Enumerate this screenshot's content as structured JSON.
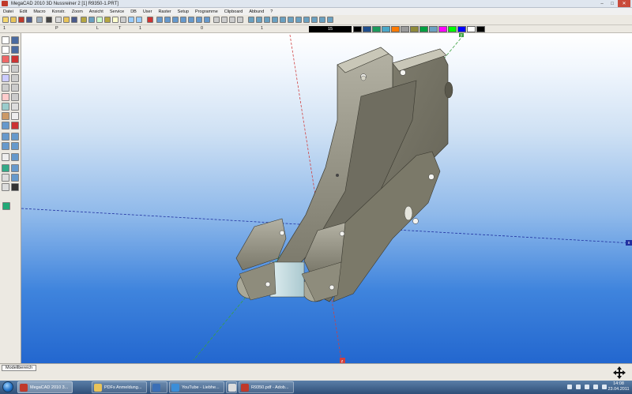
{
  "window": {
    "title": "MegaCAD 2010 3D Nussreiner 2 [1] R9350-1.PRT]",
    "controls": [
      "–",
      "□",
      "✕"
    ]
  },
  "menu": [
    "Datei",
    "Edit",
    "Macro",
    "Konstr.",
    "Zoom",
    "Ansicht",
    "Service",
    "DB",
    "User",
    "Raster",
    "Setup",
    "Programme",
    "Clipboard",
    "Abbund",
    "?"
  ],
  "layerbar": {
    "layer_value": "15",
    "fields": [
      "1",
      "P",
      "L",
      "T",
      "1",
      "0",
      "1"
    ],
    "colors": [
      "#000000",
      "#1f4e8c",
      "#1c9a5c",
      "#4aa8c8",
      "#ff7a00",
      "#9a9a9a",
      "#8f8a3a",
      "#00a040",
      "#6aa0c0",
      "#ff00ff",
      "#00ff00",
      "#0000ff",
      "#ffffff",
      "#000000"
    ]
  },
  "viewport": {
    "axis_labels": {
      "x": "x",
      "y": "y",
      "z": "z"
    },
    "background_colors": [
      "#ffffff",
      "#2367cf"
    ]
  },
  "tabs": [
    "Modellbereich"
  ],
  "taskbar": {
    "items": [
      {
        "label": "MegaCAD 2010 3...",
        "color": "#c0392b",
        "active": true
      },
      {
        "label": "PDFs Anmeldung...",
        "color": "#e8c35a",
        "active": false
      },
      {
        "label": "",
        "color": "#3b6fb6",
        "active": false
      },
      {
        "label": "YouTube - Liebhe...",
        "color": "#3b8ed8",
        "active": false
      },
      {
        "label": "",
        "color": "#dddddd",
        "active": false
      },
      {
        "label": "R9350.pdf - Adob...",
        "color": "#c0392b",
        "active": false
      }
    ],
    "clock_time": "14:08",
    "clock_date": "23.04.2011"
  }
}
